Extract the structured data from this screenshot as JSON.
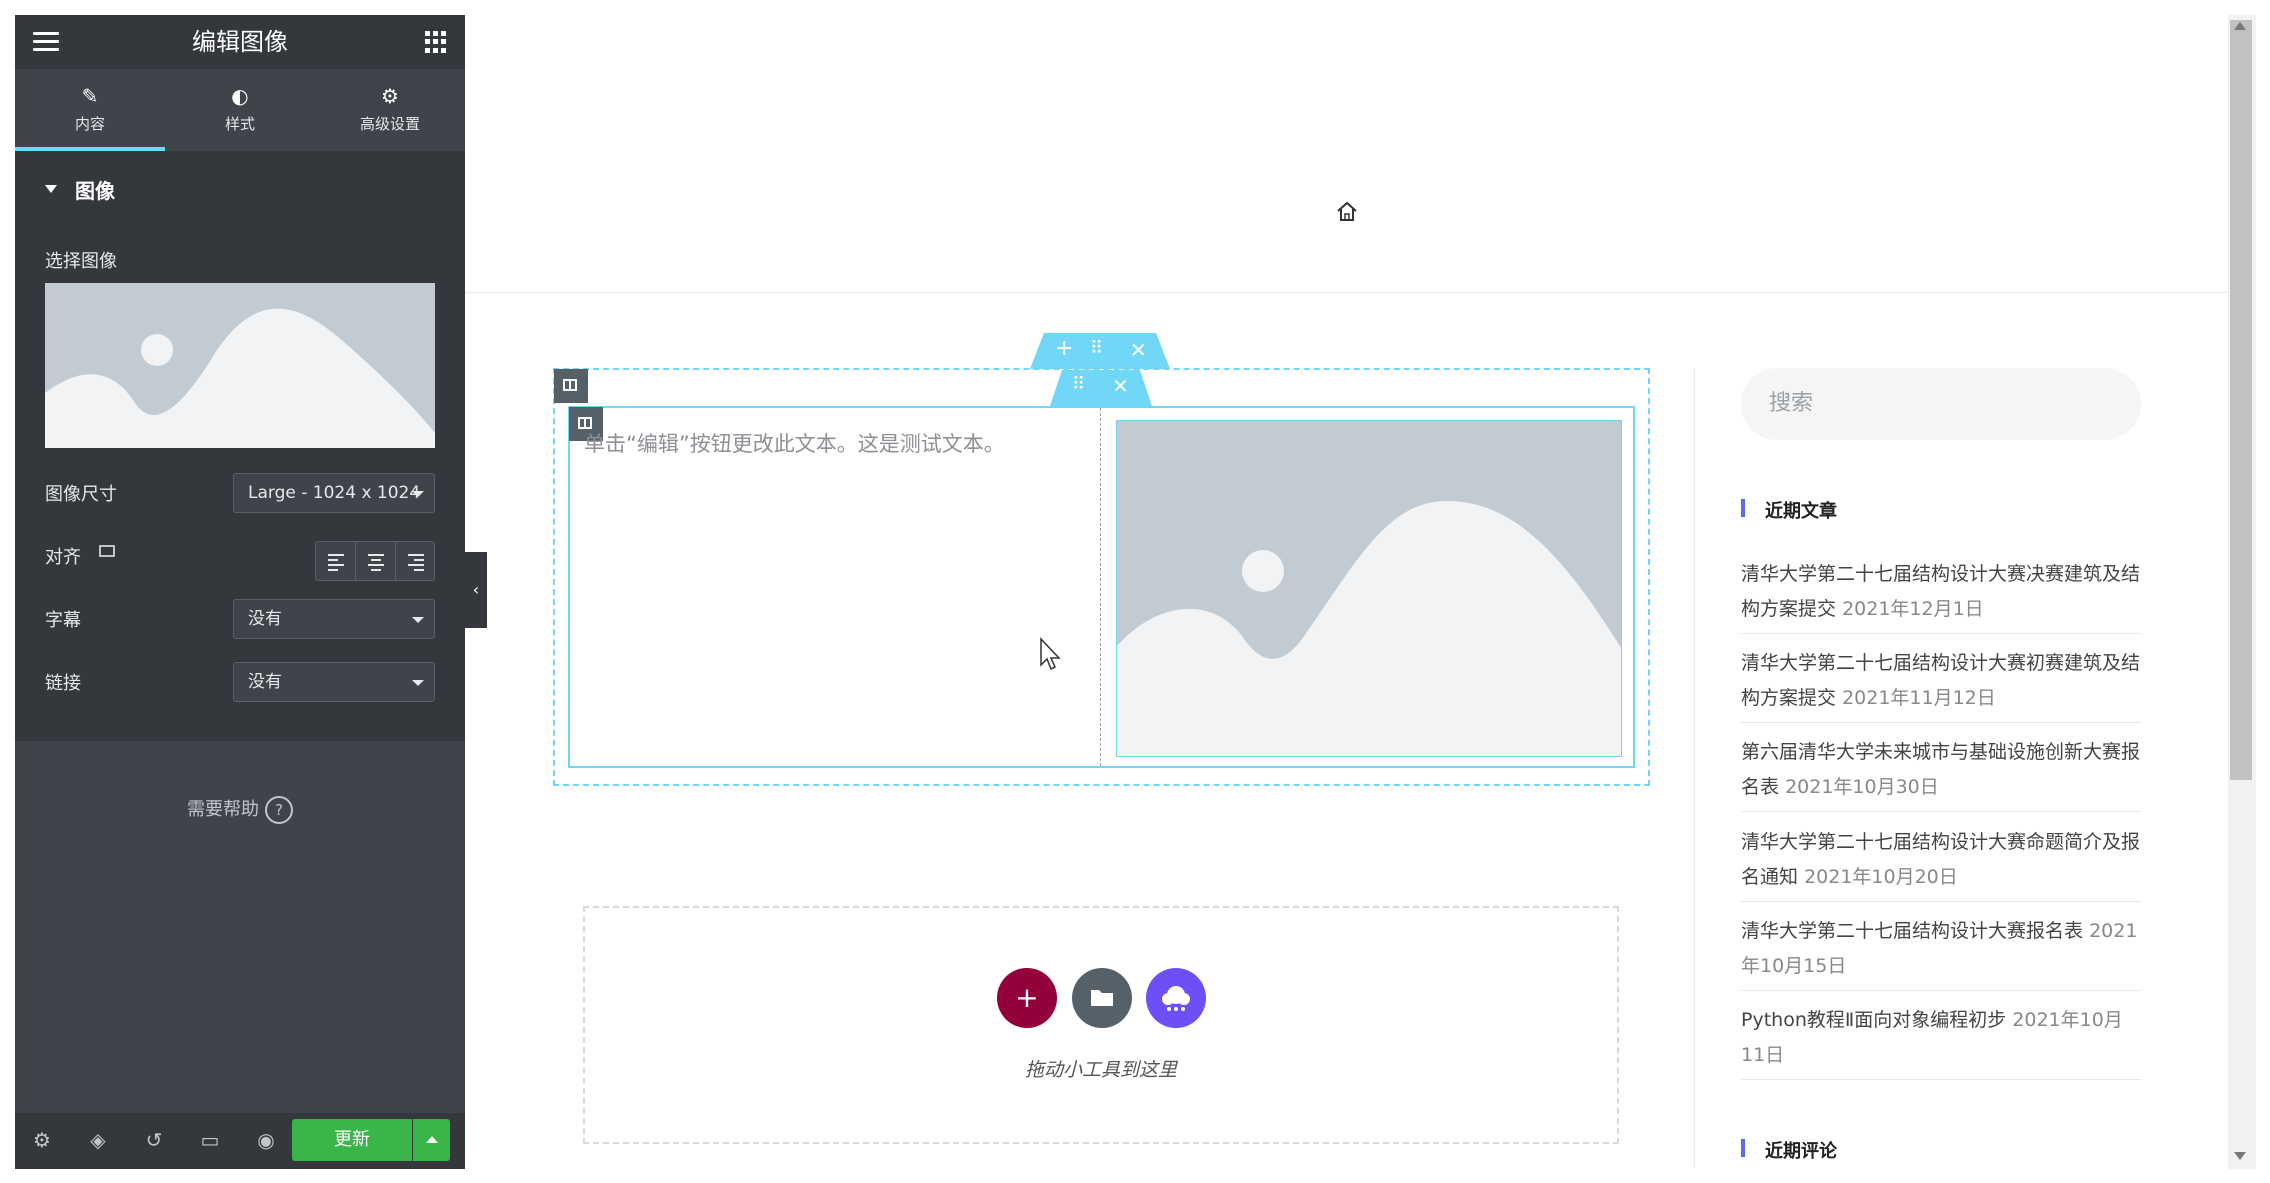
{
  "panel": {
    "title": "编辑图像",
    "tabs": [
      {
        "label": "内容",
        "icon": "pencil-icon"
      },
      {
        "label": "样式",
        "icon": "contrast-icon"
      },
      {
        "label": "高级设置",
        "icon": "gear-icon"
      }
    ],
    "section_title": "图像",
    "choose_image_label": "选择图像",
    "image_size_label": "图像尺寸",
    "image_size_value": "Large - 1024 x 1024",
    "align_label": "对齐",
    "caption_label": "字幕",
    "caption_value": "没有",
    "link_label": "链接",
    "link_value": "没有",
    "help_label": "需要帮助",
    "update_label": "更新"
  },
  "canvas": {
    "text_editor_text": "单击“编辑”按钮更改此文本。这是测试文本。",
    "drop_text": "拖动小工具到这里"
  },
  "sidebar": {
    "search_placeholder": "搜索",
    "recent_posts_title": "近期文章",
    "recent_posts": [
      {
        "title": "清华大学第二十七届结构设计大赛决赛建筑及结构方案提交",
        "date": "2021年12月1日"
      },
      {
        "title": "清华大学第二十七届结构设计大赛初赛建筑及结构方案提交",
        "date": "2021年11月12日"
      },
      {
        "title": "第六届清华大学未来城市与基础设施创新大赛报名表",
        "date": "2021年10月30日"
      },
      {
        "title": "清华大学第二十七届结构设计大赛命题简介及报名通知",
        "date": "2021年10月20日"
      },
      {
        "title": "清华大学第二十七届结构设计大赛报名表",
        "date": "2021年10月15日"
      },
      {
        "title": "Python教程Ⅱ面向对象编程初步",
        "date": "2021年10月11日"
      }
    ],
    "recent_comments_title": "近期评论"
  },
  "colors": {
    "accent": "#71d7f7",
    "update_button": "#39b54a",
    "add_button": "#93003c",
    "folder_button": "#556068",
    "ai_button": "#6e4ff5"
  }
}
